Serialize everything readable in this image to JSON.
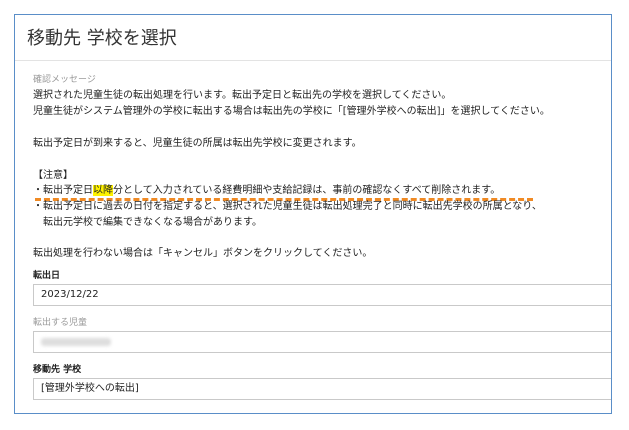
{
  "dialog": {
    "title": "移動先 学校を選択"
  },
  "message": {
    "caption": "確認メッセージ",
    "line1": "選択された児童生徒の転出処理を行います。転出予定日と転出先の学校を選択してください。",
    "line2": "児童生徒がシステム管理外の学校に転出する場合は転出先の学校に「[管理外学校への転出]」を選択してください。",
    "line3": "転出予定日が到来すると、児童生徒の所属は転出先学校に変更されます。",
    "notice_title": "【注意】",
    "notice1_pre": "・転出予定日",
    "notice1_highlight": "以降",
    "notice1_post": "分として入力されている経費明細や支給記録は、事前の確認なくすべて削除されます。",
    "notice2_line1": "・転出予定日に過去の日付を指定すると、選択された児童生徒は転出処理完了と同時に転出先学校の所属となり、",
    "notice2_line2": "　転出元学校で編集できなくなる場合があります。",
    "cancel_note": "転出処理を行わない場合は「キャンセル」ボタンをクリックしてください。"
  },
  "form": {
    "transfer_date_label": "転出日",
    "transfer_date_value": "2023/12/22",
    "student_label": "転出する児童",
    "destination_label": "移動先 学校",
    "destination_value": "[管理外学校への転出]"
  },
  "colors": {
    "dialog_border": "#5a8ec8",
    "highlight": "#fff200",
    "annotation_underline": "#f08a24"
  }
}
